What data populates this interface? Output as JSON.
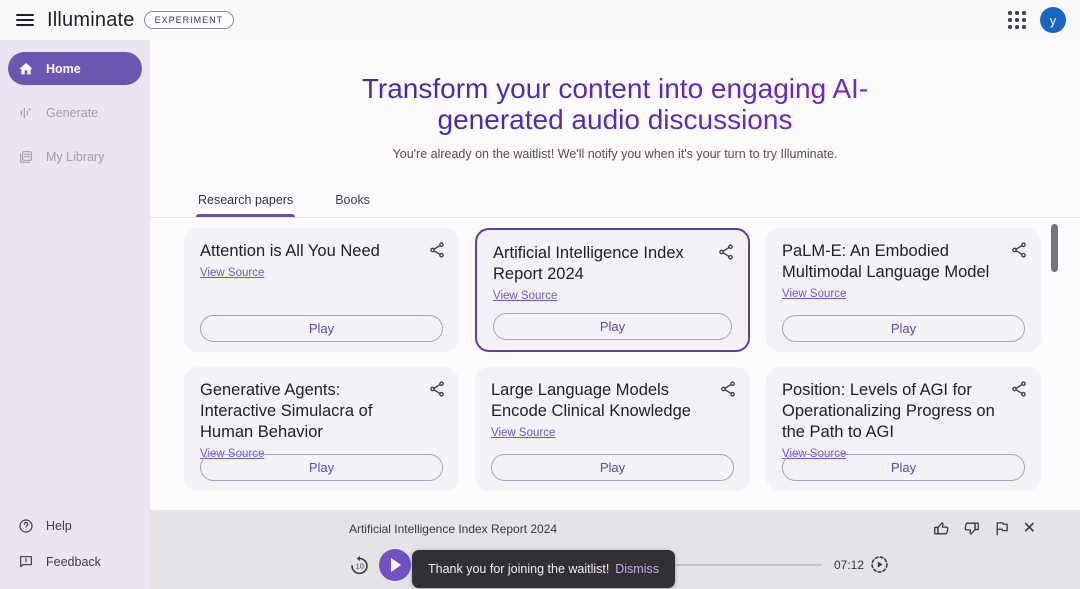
{
  "topbar": {
    "app_name": "Illuminate",
    "badge": "EXPERIMENT",
    "avatar_letter": "y",
    "avatar_color": "#1766c2"
  },
  "sidebar": {
    "home": "Home",
    "generate": "Generate",
    "my_library": "My Library",
    "help": "Help",
    "feedback": "Feedback"
  },
  "hero": {
    "title_line1": "Transform your content into engaging AI-",
    "title_line2": "generated audio discussions",
    "subtitle": "You're already on the waitlist! We'll notify you when it's your turn to try Illuminate."
  },
  "tabs": {
    "research_papers": "Research papers",
    "books": "Books"
  },
  "card_labels": {
    "view_source": "View Source",
    "play": "Play"
  },
  "cards": [
    {
      "title": "Attention is All You Need",
      "selected": false
    },
    {
      "title": "Artificial Intelligence Index Report 2024",
      "selected": true
    },
    {
      "title": "PaLM-E: An Embodied Multimodal Language Model",
      "selected": false
    },
    {
      "title": "Generative Agents: Interactive Simulacra of Human Behavior",
      "selected": false
    },
    {
      "title": "Large Language Models Encode Clinical Knowledge",
      "selected": false
    },
    {
      "title": "Position: Levels of AGI for Operationalizing Progress on the Path to AGI",
      "selected": false
    }
  ],
  "player": {
    "track_title": "Artificial Intelligence Index Report 2024",
    "time": "07:12",
    "replay_seconds": "10"
  },
  "toast": {
    "message": "Thank you for joining the waitlist!",
    "action": "Dismiss"
  },
  "icons": {
    "close": "✕"
  },
  "colors": {
    "accent_purple": "#6b57b0",
    "selected_border": "#5d3fa8",
    "headline_gradient_start": "#2a2f9e",
    "headline_gradient_end": "#8a21c9",
    "toast_bg": "#322f35",
    "player_bg": "#e5e2e8",
    "sidebar_bg": "#ebe5f2"
  }
}
